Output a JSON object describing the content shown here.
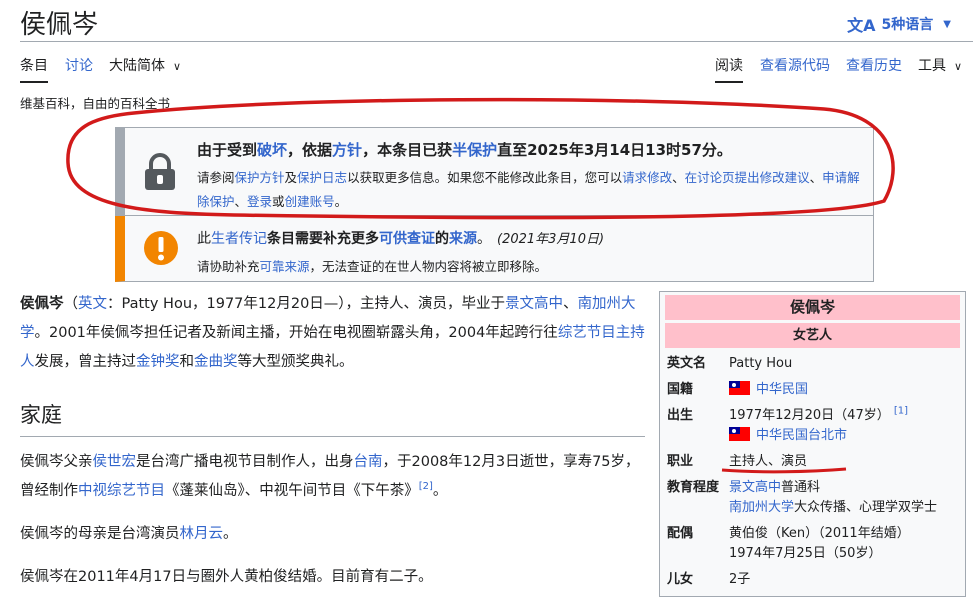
{
  "page": {
    "title": "侯佩岑",
    "lang_button": "5种语言",
    "lang_icon": "文A"
  },
  "tabs": {
    "article": "条目",
    "talk": "讨论",
    "variant": "大陆简体",
    "read": "阅读",
    "view_source": "查看源代码",
    "history": "查看历史",
    "tools": "工具"
  },
  "site_subtitle": "维基百科，自由的百科全书",
  "protect_box": {
    "m1": "由于受到",
    "m_vandal": "破坏",
    "m2": "，依据",
    "m_policy": "方针",
    "m3": "，本条目已获",
    "m_semi": "半保护",
    "m4": "直至2025年3月14日13时57分。",
    "s1": "请参阅",
    "s_policy": "保护方针",
    "s2": "及",
    "s_log": "保护日志",
    "s3": "以获取更多信息。如果您不能修改此条目，您可以",
    "s_request": "请求修改",
    "s4": "、",
    "s_talk": "在讨论页提出修改建议",
    "s5": "、",
    "s_unprotect": "申请解除保护",
    "s6": "、",
    "s_login": "登录",
    "s7": "或",
    "s_create": "创建账号",
    "s8": "。"
  },
  "issue_box": {
    "m1": "此",
    "m_blp": "生者传记",
    "m2": "条目需要补充更多",
    "m_verifiable": "可供查证",
    "m3": "的",
    "m_sources": "来源",
    "m4": "。",
    "date": "(2021年3月10日)",
    "s1": "请协助补充",
    "s_reliable": "可靠来源",
    "s2": "，无法查证的在世人物内容将被立即移除。"
  },
  "intro": {
    "name": "侯佩岑",
    "t1": "（",
    "l_english": "英文",
    "t2": "：Patty Hou，1977年12月20日—），主持人、演员，毕业于",
    "l_school": "景文高中",
    "t3": "、",
    "l_usc": "南加州大学",
    "t4": "。2001年侯佩岑担任记者及新闻主播，开始在电视圈崭露头角，2004年起跨行往",
    "l_variety_host": "综艺节目主持人",
    "t5": "发展，曾主持过",
    "l_golden_bell": "金钟奖",
    "t6": "和",
    "l_golden_melody": "金曲奖",
    "t7": "等大型颁奖典礼。"
  },
  "family": {
    "heading": "家庭",
    "p1": {
      "t1": "侯佩岑父亲",
      "l_father": "侯世宏",
      "t2": "是台湾广播电视节目制作人，出身",
      "l_tainan": "台南",
      "t3": "，于2008年12月3日逝世，享寿75岁，曾经制作",
      "l_ctv_variety": "中视综艺节目",
      "t4": "《蓬莱仙岛》、中视午间节目《下午茶》",
      "ref": "[2]",
      "t5": "。"
    },
    "p2": {
      "t1": "侯佩岑的母亲是台湾演员",
      "l_mother": "林月云",
      "t2": "。"
    },
    "p3": "侯佩岑在2011年4月17日与圈外人黄柏俊结婚。目前育有二子。"
  },
  "infobox": {
    "name": "侯佩岑",
    "occupation_header": "女艺人",
    "rows": {
      "english_label": "英文名",
      "english_value": "Patty Hou",
      "nationality_label": "国籍",
      "nationality_value": "中华民国",
      "born_label": "出生",
      "born_date": "1977年12月20日（47岁）",
      "born_ref": "[1]",
      "born_place": "中华民国台北市",
      "occupation_label": "职业",
      "occupation_value": "主持人、演员",
      "education_label": "教育程度",
      "edu_school1": "景文高中",
      "edu_school1_suffix": "普通科",
      "edu_school2": "南加州大学",
      "edu_school2_suffix": "大众传播、心理学双学士",
      "spouse_label": "配偶",
      "spouse_value": "黄伯俊（Ken）（2011年结婚）",
      "spouse_born": "1974年7月25日（50岁）",
      "children_label": "儿女",
      "children_value": "2子"
    }
  },
  "colors": {
    "link": "#3366cc",
    "infobox_header": "#ffc0cb",
    "annotation": "#d21a1a",
    "issue_stripe": "#f28500"
  }
}
